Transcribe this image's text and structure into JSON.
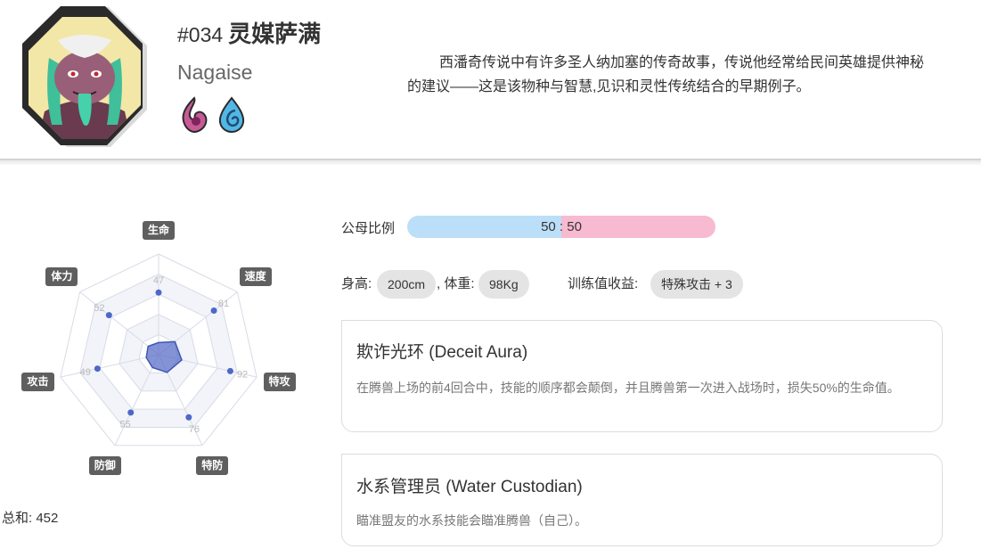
{
  "monster": {
    "number": "#034",
    "name_cn": "灵媒萨满",
    "name_en": "Nagaise",
    "types": [
      "spirit-type-icon",
      "water-type-icon"
    ],
    "description_line1": "西潘奇传说中有许多圣人纳加塞的传奇故事，传说他经常给民间英雄提供神秘",
    "description_line2": "的建议——这是该物种与智慧,见识和灵性传统结合的早期例子。"
  },
  "radar": {
    "stats": [
      {
        "label": "生命",
        "value": 47
      },
      {
        "label": "速度",
        "value": 81
      },
      {
        "label": "特攻",
        "value": 92
      },
      {
        "label": "特防",
        "value": 76
      },
      {
        "label": "防御",
        "value": 55
      },
      {
        "label": "攻击",
        "value": 49
      },
      {
        "label": "体力",
        "value": 52
      }
    ],
    "total_text": "总和: 452",
    "colors": {
      "fill": "#5a6fc8",
      "point": "#4e68c7",
      "grid": "#d8dbe6",
      "band": "#f2f4fa"
    }
  },
  "gender": {
    "label": "公母比例",
    "ratio_text": "50 : 50",
    "male_fraction": 0.5,
    "male_color": "#bcdff9",
    "female_color": "#f8bad0"
  },
  "stats_row": {
    "height_label": "身高:",
    "height_value": "200cm",
    "weight_label": ", 体重:",
    "weight_value": "98Kg",
    "ev_label": "训练值收益:",
    "ev_value": "特殊攻击 + 3"
  },
  "abilities": [
    {
      "name": "欺诈光环 (Deceit Aura)",
      "desc": "在腾兽上场的前4回合中，技能的顺序都会颠倒，并且腾兽第一次进入战场时，损失50%的生命值。"
    },
    {
      "name": "水系管理员 (Water Custodian)",
      "desc": "瞄准盟友的水系技能会瞄准腾兽（自己）。"
    }
  ]
}
